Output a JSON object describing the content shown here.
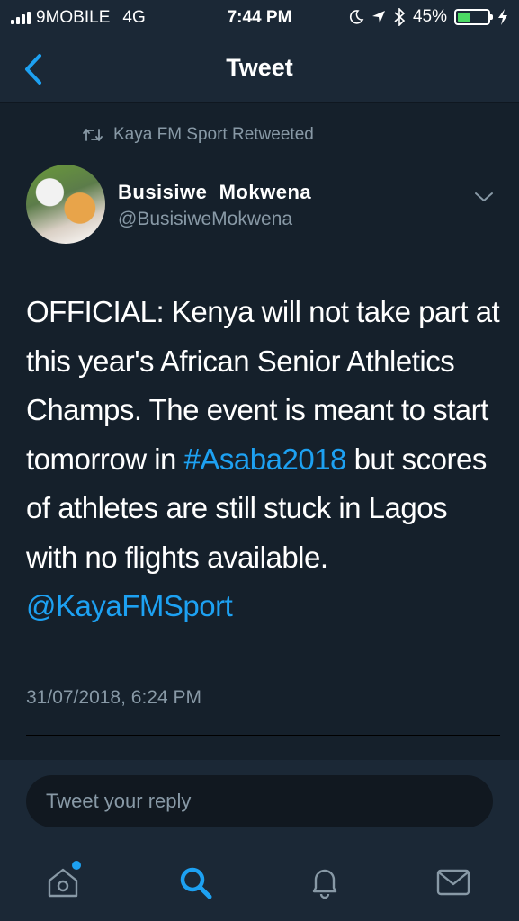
{
  "status_bar": {
    "carrier": "9MOBILE",
    "network": "4G",
    "time": "7:44 PM",
    "battery_percent": "45%",
    "battery_level": 0.45
  },
  "nav": {
    "title": "Tweet",
    "back_icon": "chevron-left-icon"
  },
  "tweet": {
    "retweeted_by": "Kaya FM Sport Retweeted",
    "author_name": "Busisiwe  Mokwena",
    "author_handle": "@BusisiweMokwena",
    "text_part1": "OFFICIAL: Kenya will not take part at this year's African Senior Athletics Champs. The event is meant to start tomorrow in ",
    "hashtag": "#Asaba2018",
    "text_part2": " but scores of athletes are still stuck in Lagos with no flights available. ",
    "mention": "@KayaFMSport",
    "timestamp": "31/07/2018, 6:24 PM"
  },
  "reply": {
    "placeholder": "Tweet your reply"
  },
  "tabs": [
    "home-icon",
    "search-icon",
    "bell-icon",
    "mail-icon"
  ],
  "colors": {
    "background": "#15202b",
    "bar": "#1b2836",
    "accent": "#1da1f2",
    "muted": "#8899a6"
  }
}
